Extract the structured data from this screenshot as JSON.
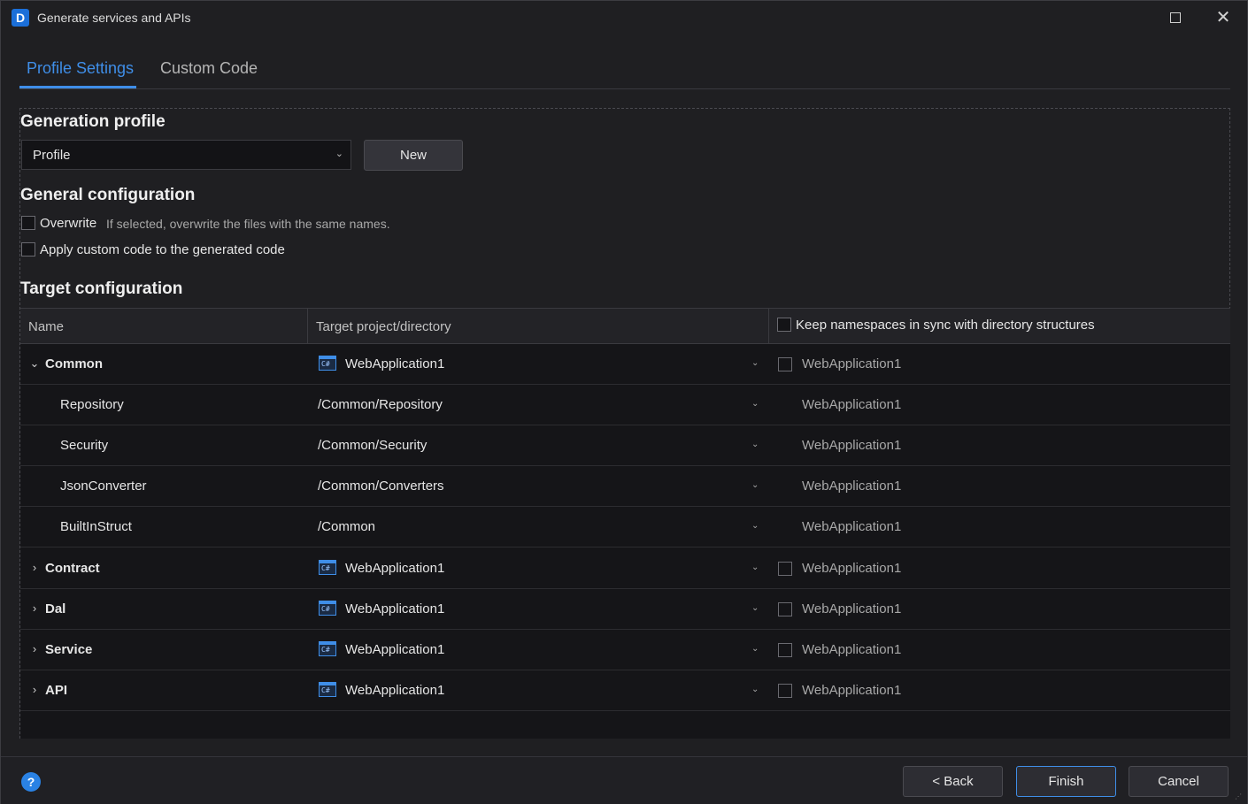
{
  "window": {
    "title": "Generate services and APIs",
    "app_icon_letter": "D"
  },
  "tabs": [
    {
      "label": "Profile Settings",
      "active": true
    },
    {
      "label": "Custom Code",
      "active": false
    }
  ],
  "generation_profile": {
    "title": "Generation profile",
    "selected": "Profile",
    "new_label": "New"
  },
  "general_configuration": {
    "title": "General configuration",
    "overwrite_label": "Overwrite",
    "overwrite_desc": "If selected, overwrite the files with the same names.",
    "overwrite_checked": false,
    "apply_label": "Apply custom code to the generated code",
    "apply_checked": false
  },
  "target_configuration": {
    "title": "Target configuration",
    "columns": {
      "name": "Name",
      "target": "Target project/directory",
      "keep_ns": "Keep namespaces in sync with directory structures"
    },
    "rows": [
      {
        "name": "Common",
        "group": true,
        "expanded": true,
        "target": "WebApplication1",
        "namespace": "WebApplication1"
      },
      {
        "name": "Repository",
        "group": false,
        "target": "/Common/Repository",
        "namespace": "WebApplication1"
      },
      {
        "name": "Security",
        "group": false,
        "target": "/Common/Security",
        "namespace": "WebApplication1"
      },
      {
        "name": "JsonConverter",
        "group": false,
        "target": "/Common/Converters",
        "namespace": "WebApplication1"
      },
      {
        "name": "BuiltInStruct",
        "group": false,
        "target": "/Common",
        "namespace": "WebApplication1"
      },
      {
        "name": "Contract",
        "group": true,
        "expanded": false,
        "target": "WebApplication1",
        "namespace": "WebApplication1"
      },
      {
        "name": "Dal",
        "group": true,
        "expanded": false,
        "target": "WebApplication1",
        "namespace": "WebApplication1"
      },
      {
        "name": "Service",
        "group": true,
        "expanded": false,
        "target": "WebApplication1",
        "namespace": "WebApplication1"
      },
      {
        "name": "API",
        "group": true,
        "expanded": false,
        "target": "WebApplication1",
        "namespace": "WebApplication1"
      }
    ]
  },
  "footer": {
    "help": "?",
    "back": "< Back",
    "finish": "Finish",
    "cancel": "Cancel"
  },
  "icons": {
    "project": "csharp-project-icon",
    "csharp_text": "C#"
  },
  "colors": {
    "accent": "#3f8ee8",
    "background": "#1f1f22",
    "table_background": "#151518"
  }
}
